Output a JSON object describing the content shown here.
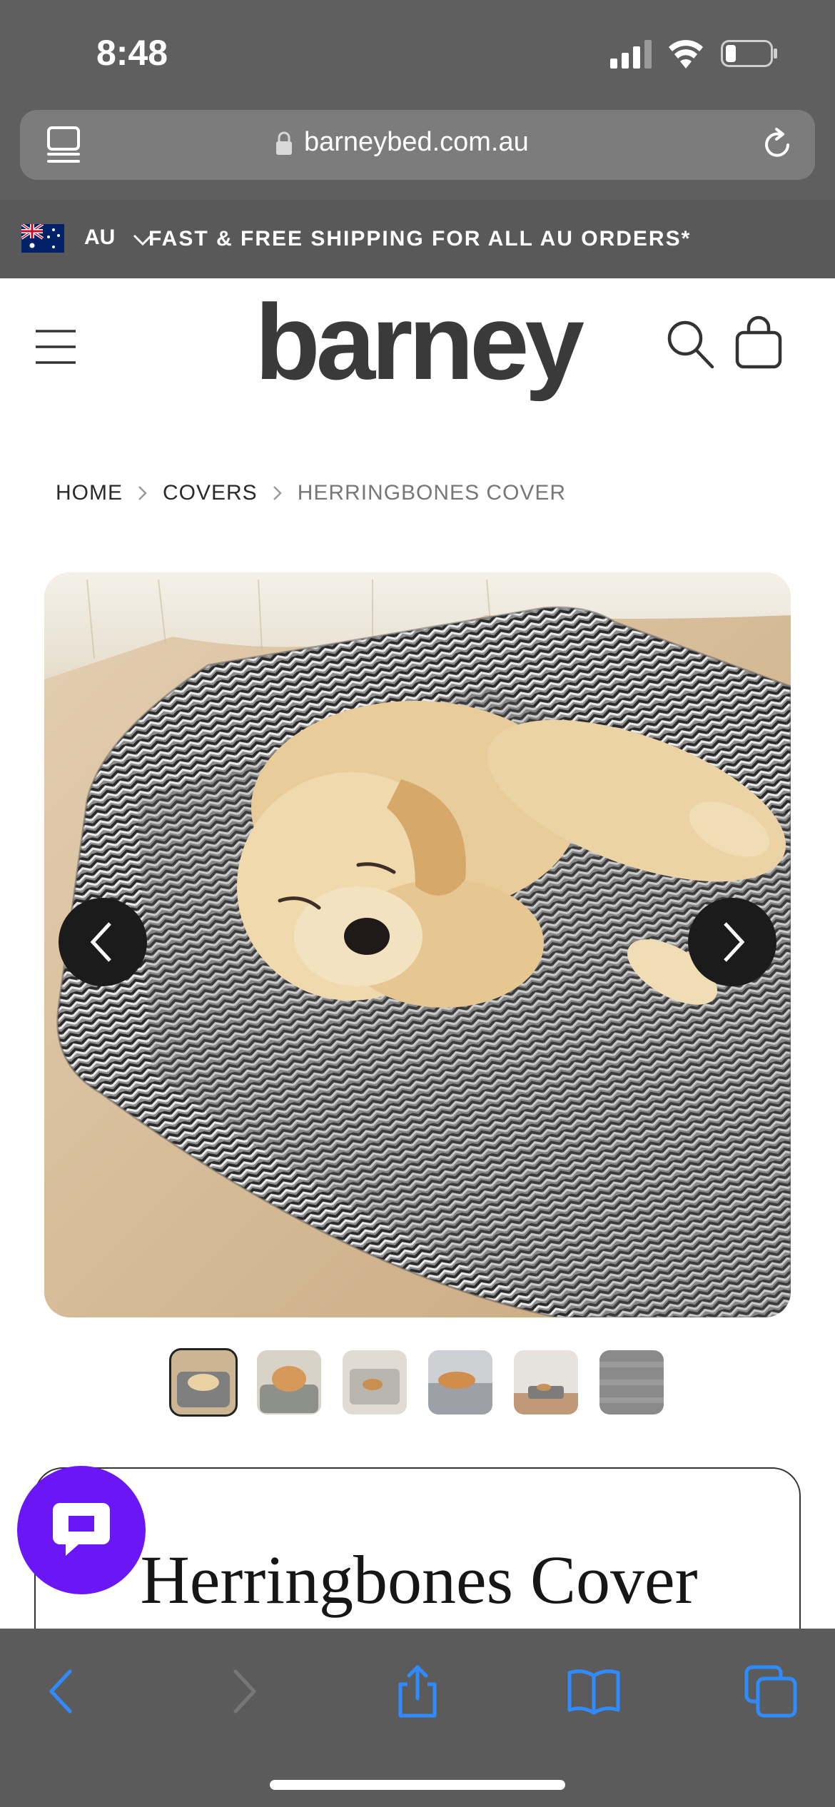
{
  "status_bar": {
    "time": "8:48"
  },
  "browser": {
    "url": "barneybed.com.au"
  },
  "announcement": {
    "country_code": "AU",
    "message": "FAST & FREE SHIPPING FOR ALL AU ORDERS*"
  },
  "header": {
    "logo_text": "barney"
  },
  "breadcrumb": {
    "items": [
      "HOME",
      "COVERS",
      "HERRINGBONES COVER"
    ]
  },
  "gallery": {
    "thumbnail_count": 6,
    "active_index": 0
  },
  "product": {
    "title": "Herringbones Cover"
  },
  "icons": {
    "menu": "hamburger-menu-icon",
    "search": "search-icon",
    "cart": "shopping-bag-icon",
    "chat": "chat-bubble-icon",
    "back": "back-chevron-icon",
    "forward": "forward-chevron-icon",
    "share": "share-icon",
    "bookmarks": "book-icon",
    "tabs": "tabs-icon"
  },
  "colors": {
    "chat_button": "#6a16f5",
    "safari_chrome": "#5f5f5f",
    "toolbar_accent": "#2f8bff"
  }
}
